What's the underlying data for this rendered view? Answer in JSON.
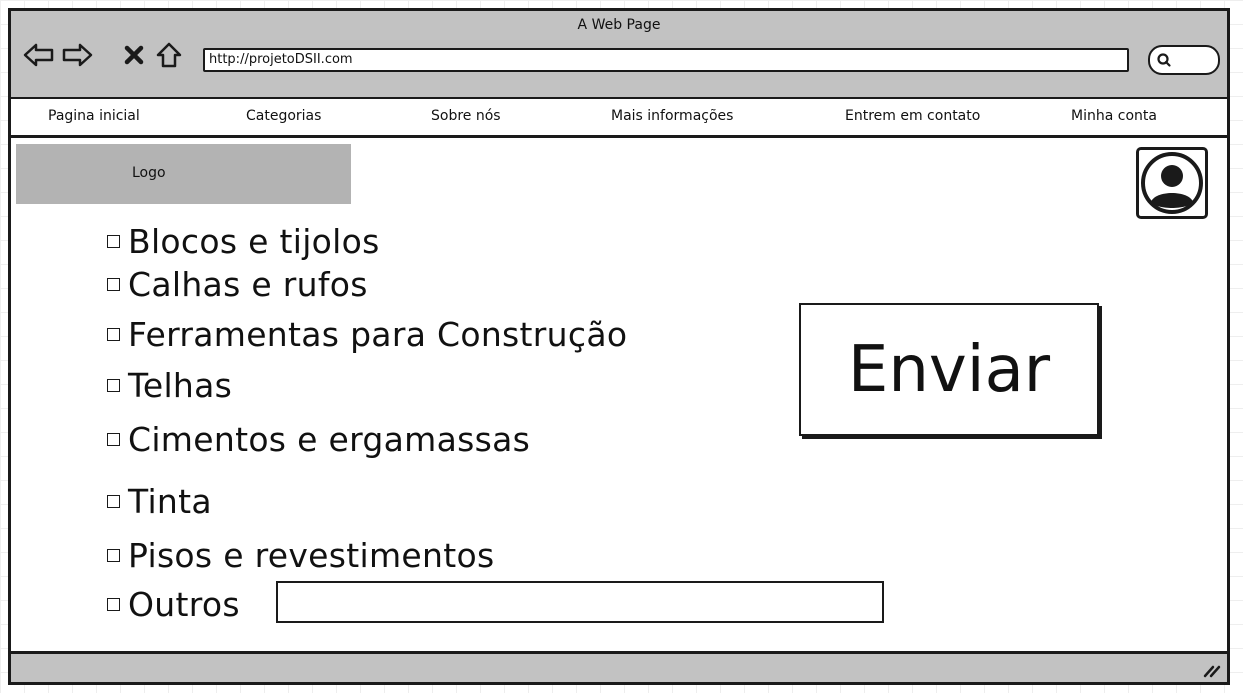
{
  "window": {
    "title": "A Web Page",
    "url": "http://projetoDSII.com"
  },
  "toolbar": {
    "back_icon": "back-arrow-icon",
    "forward_icon": "forward-arrow-icon",
    "stop_icon": "close-icon",
    "home_icon": "home-icon",
    "search_icon": "search-icon"
  },
  "menu": {
    "items": [
      {
        "label": "Pagina inicial"
      },
      {
        "label": "Categorias"
      },
      {
        "label": "Sobre nós"
      },
      {
        "label": "Mais informações"
      },
      {
        "label": "Entrem em contato"
      },
      {
        "label": "Minha conta"
      }
    ]
  },
  "logo": {
    "label": "Logo"
  },
  "categories": {
    "items": [
      {
        "label": "Blocos e tijolos",
        "checked": false
      },
      {
        "label": "Calhas e rufos",
        "checked": false
      },
      {
        "label": "Ferramentas para Construção",
        "checked": false
      },
      {
        "label": "Telhas",
        "checked": false
      },
      {
        "label": "Cimentos e ergamassas",
        "checked": false
      },
      {
        "label": "Tinta",
        "checked": false
      },
      {
        "label": "Pisos e revestimentos",
        "checked": false
      },
      {
        "label": "Outros",
        "checked": false
      }
    ],
    "outros_value": ""
  },
  "submit": {
    "label": "Enviar"
  },
  "colors": {
    "chrome_gray": "#c2c2c2",
    "logo_gray": "#b3b3b3",
    "ink": "#1a1a1a"
  }
}
